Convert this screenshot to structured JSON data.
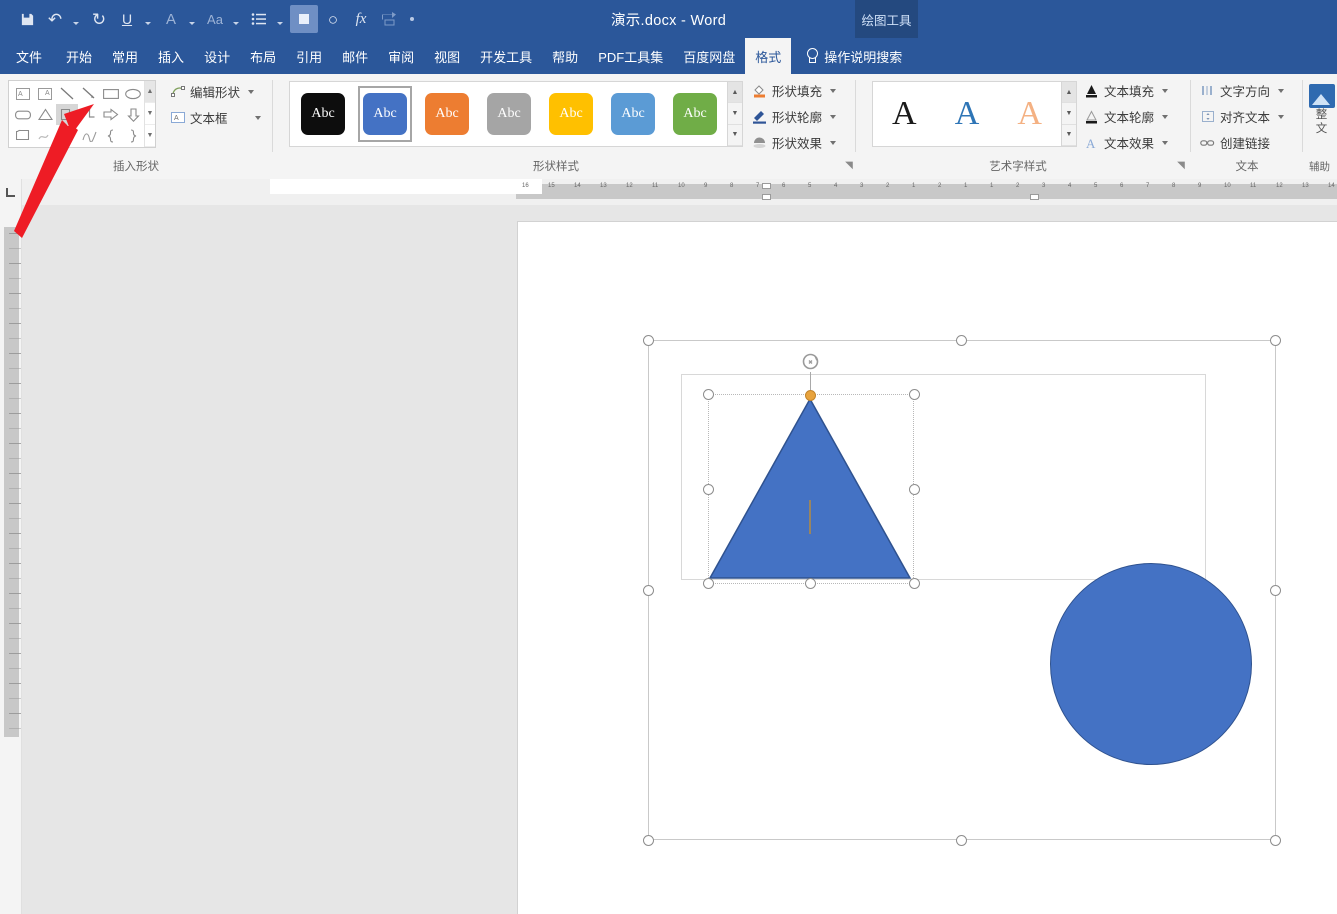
{
  "titlebar": {
    "document_title": "演示.docx  -  Word",
    "contextual_tab_group": "绘图工具",
    "quick_access": [
      {
        "name": "save-icon",
        "glyph": "Ὃe"
      },
      {
        "name": "undo-icon",
        "glyph": "↶"
      },
      {
        "name": "redo-icon",
        "glyph": "↻"
      },
      {
        "name": "underline-icon",
        "glyph": "U"
      },
      {
        "name": "font-color-icon",
        "glyph": "A"
      },
      {
        "name": "change-case-icon",
        "glyph": "Aa"
      },
      {
        "name": "bullet-list-icon",
        "glyph": "≡"
      },
      {
        "name": "highlight-icon",
        "glyph": "■"
      },
      {
        "name": "circle-icon",
        "glyph": "○"
      },
      {
        "name": "formula-icon",
        "glyph": "fx"
      },
      {
        "name": "repeat-icon",
        "glyph": "❐"
      },
      {
        "name": "customize-qat-icon",
        "glyph": "•"
      }
    ]
  },
  "tabs": [
    {
      "label": "文件",
      "active": false
    },
    {
      "label": "开始",
      "active": false
    },
    {
      "label": "常用",
      "active": false
    },
    {
      "label": "插入",
      "active": false
    },
    {
      "label": "设计",
      "active": false
    },
    {
      "label": "布局",
      "active": false
    },
    {
      "label": "引用",
      "active": false
    },
    {
      "label": "邮件",
      "active": false
    },
    {
      "label": "审阅",
      "active": false
    },
    {
      "label": "视图",
      "active": false
    },
    {
      "label": "开发工具",
      "active": false
    },
    {
      "label": "帮助",
      "active": false
    },
    {
      "label": "PDF工具集",
      "active": false
    },
    {
      "label": "百度网盘",
      "active": false
    },
    {
      "label": "格式",
      "active": true
    }
  ],
  "tell_me": {
    "label": "操作说明搜索",
    "icon": "lightbulb-icon"
  },
  "ribbon": {
    "groups": [
      {
        "name": "insert-shapes",
        "label": "插入形状"
      },
      {
        "name": "shape-styles",
        "label": "形状样式"
      },
      {
        "name": "wordart-styles",
        "label": "艺术字样式"
      },
      {
        "name": "text",
        "label": "文本"
      },
      {
        "name": "accessibility",
        "label": "辅助..."
      }
    ],
    "insert_shapes": {
      "gallery_rows": [
        [
          "text-box-icon",
          "vertical-text-box-icon",
          "line-icon",
          "line-arrow-icon",
          "rectangle-icon",
          "oval-icon"
        ],
        [
          "rounded-rectangle-icon",
          "triangle-icon",
          "right-angle-shape-icon",
          "elbow-connector-icon",
          "right-arrow-icon",
          "down-arrow-icon"
        ],
        [
          "pentagon-icon",
          "chevron-icon",
          "scribble-icon",
          "curve-icon",
          "left-brace-icon",
          "right-brace-icon"
        ]
      ],
      "selected_cell": "right-angle-shape-icon",
      "buttons": [
        {
          "name": "edit-shape-button",
          "label": "编辑形状",
          "icon": "edit-shape-icon",
          "dropdown": true
        },
        {
          "name": "text-box-button",
          "label": "文本框",
          "icon": "text-box-icon",
          "dropdown": true
        }
      ]
    },
    "shape_styles": {
      "thumbnails": [
        {
          "label": "Abc",
          "fill": "#0d0d0d",
          "text": "#ffffff",
          "selected": false
        },
        {
          "label": "Abc",
          "fill": "#4472c4",
          "text": "#ffffff",
          "selected": true
        },
        {
          "label": "Abc",
          "fill": "#ed7d31",
          "text": "#ffffff",
          "selected": false
        },
        {
          "label": "Abc",
          "fill": "#a5a5a5",
          "text": "#ffffff",
          "selected": false
        },
        {
          "label": "Abc",
          "fill": "#ffc000",
          "text": "#ffffff",
          "selected": false
        },
        {
          "label": "Abc",
          "fill": "#5b9bd5",
          "text": "#ffffff",
          "selected": false
        },
        {
          "label": "Abc",
          "fill": "#70ad47",
          "text": "#ffffff",
          "selected": false
        }
      ],
      "buttons": [
        {
          "name": "shape-fill-button",
          "label": "形状填充",
          "icon": "paint-bucket-icon",
          "accent": "#ed7d31",
          "dropdown": true
        },
        {
          "name": "shape-outline-button",
          "label": "形状轮廓",
          "icon": "pen-outline-icon",
          "accent": "#2f5597",
          "dropdown": true
        },
        {
          "name": "shape-effects-button",
          "label": "形状效果",
          "icon": "shape-effects-icon",
          "accent": "#808080",
          "dropdown": true
        }
      ]
    },
    "wordart_styles": {
      "thumbnails": [
        {
          "label": "A",
          "color": "#1a1a1a"
        },
        {
          "label": "A",
          "color": "#2e75b6"
        },
        {
          "label": "A",
          "color": "#f4b183"
        }
      ],
      "buttons": [
        {
          "name": "text-fill-button",
          "label": "文本填充",
          "icon": "text-fill-icon",
          "dropdown": true
        },
        {
          "name": "text-outline-button",
          "label": "文本轮廓",
          "icon": "text-outline-icon",
          "dropdown": true
        },
        {
          "name": "text-effects-button",
          "label": "文本效果",
          "icon": "text-effects-icon",
          "dropdown": true
        }
      ]
    },
    "text_group": {
      "buttons": [
        {
          "name": "text-direction-button",
          "label": "文字方向",
          "icon": "text-direction-icon",
          "dropdown": true
        },
        {
          "name": "align-text-button",
          "label": "对齐文本",
          "icon": "align-text-icon",
          "dropdown": true
        },
        {
          "name": "create-link-button",
          "label": "创建链接",
          "icon": "link-icon",
          "dropdown": false
        }
      ]
    },
    "accessibility_group": {
      "button_label_line1": "整",
      "button_label_line2": "文",
      "group_label": "辅助"
    }
  },
  "document": {
    "shapes": [
      {
        "name": "triangle-shape",
        "type": "triangle",
        "fill": "#4472c4",
        "stroke": "#2f528f",
        "selected": true
      },
      {
        "name": "circle-shape",
        "type": "circle",
        "fill": "#4472c4",
        "stroke": "#2f528f",
        "selected": false
      }
    ],
    "canvas_selected": true
  },
  "annotation": {
    "arrow_color": "#ee1c25",
    "name": "red-pointer-arrow",
    "points_to": "right-angle-shape-icon"
  }
}
